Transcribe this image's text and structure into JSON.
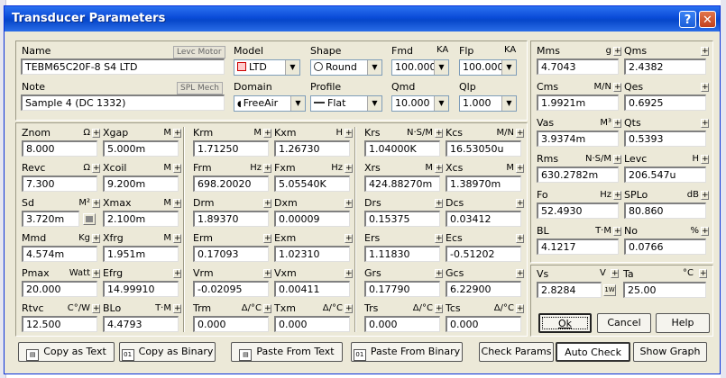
{
  "window": {
    "title": "Transducer Parameters",
    "help_glyph": "?",
    "close_glyph": "✕"
  },
  "header": {
    "name_label": "Name",
    "name_value": "TEBM65C20F-8 S4 LTD",
    "name_button": "Levc Motor",
    "note_label": "Note",
    "note_value": "Sample 4 (DC 1332)",
    "note_button": "SPL Mech",
    "model_label": "Model",
    "model_value": "LTD",
    "shape_label": "Shape",
    "shape_value": "Round",
    "fmd_label": "Fmd",
    "fmd_unit": "KA",
    "fmd_value": "100.000",
    "flp_label": "Flp",
    "flp_unit": "KA",
    "flp_value": "100.000",
    "domain_label": "Domain",
    "domain_value": "FreeAir",
    "profile_label": "Profile",
    "profile_value": "Flat",
    "qmd_label": "Qmd",
    "qmd_value": "10.000",
    "qlp_label": "Qlp",
    "qlp_value": "1.000"
  },
  "params_left": [
    {
      "label": "Znom",
      "unit": "Ω",
      "value": "8.000"
    },
    {
      "label": "Xgap",
      "unit": "M",
      "value": "5.000m"
    },
    {
      "label": "Revc",
      "unit": "Ω",
      "value": "7.300"
    },
    {
      "label": "Xcoil",
      "unit": "M",
      "value": "9.200m"
    },
    {
      "label": "Sd",
      "unit": "M²",
      "value": "3.720m"
    },
    {
      "label": "Xmax",
      "unit": "M",
      "value": "2.100m"
    },
    {
      "label": "Mmd",
      "unit": "Kg",
      "value": "4.574m"
    },
    {
      "label": "Xfrg",
      "unit": "M",
      "value": "1.951m"
    },
    {
      "label": "Pmax",
      "unit": "Watt",
      "value": "20.000"
    },
    {
      "label": "Efrg",
      "unit": "",
      "value": "14.99910"
    },
    {
      "label": "Rtvc",
      "unit": "C°/W",
      "value": "12.500"
    },
    {
      "label": "BLo",
      "unit": "T·M",
      "value": "4.4793"
    }
  ],
  "params_mid": [
    {
      "label": "Krm",
      "unit": "M",
      "value": "1.71250"
    },
    {
      "label": "Kxm",
      "unit": "H",
      "value": "1.26730"
    },
    {
      "label": "Frm",
      "unit": "Hz",
      "value": "698.20020"
    },
    {
      "label": "Fxm",
      "unit": "Hz",
      "value": "5.05540K"
    },
    {
      "label": "Drm",
      "unit": "",
      "value": "1.89370"
    },
    {
      "label": "Dxm",
      "unit": "",
      "value": "0.00009"
    },
    {
      "label": "Erm",
      "unit": "",
      "value": "0.17093"
    },
    {
      "label": "Exm",
      "unit": "",
      "value": "1.02310"
    },
    {
      "label": "Vrm",
      "unit": "",
      "value": "-0.02095"
    },
    {
      "label": "Vxm",
      "unit": "",
      "value": "0.00411"
    },
    {
      "label": "Trm",
      "unit": "Δ/°C",
      "value": "0.000"
    },
    {
      "label": "Txm",
      "unit": "Δ/°C",
      "value": "0.000"
    }
  ],
  "params_right": [
    {
      "label": "Krs",
      "unit": "N·S/M",
      "value": "1.04000K"
    },
    {
      "label": "Kcs",
      "unit": "M/N",
      "value": "16.53050u"
    },
    {
      "label": "Xrs",
      "unit": "M",
      "value": "424.88270m"
    },
    {
      "label": "Xcs",
      "unit": "M",
      "value": "1.38970m"
    },
    {
      "label": "Drs",
      "unit": "",
      "value": "0.15375"
    },
    {
      "label": "Dcs",
      "unit": "",
      "value": "0.03412"
    },
    {
      "label": "Ers",
      "unit": "",
      "value": "1.11830"
    },
    {
      "label": "Ecs",
      "unit": "",
      "value": "-0.51202"
    },
    {
      "label": "Grs",
      "unit": "",
      "value": "0.17790"
    },
    {
      "label": "Gcs",
      "unit": "",
      "value": "6.22900"
    },
    {
      "label": "Trs",
      "unit": "Δ/°C",
      "value": "0.000"
    },
    {
      "label": "Tcs",
      "unit": "Δ/°C",
      "value": "0.000"
    }
  ],
  "results": [
    {
      "label": "Mms",
      "unit": "g",
      "value": "4.7043"
    },
    {
      "label": "Qms",
      "unit": "",
      "value": "2.4382"
    },
    {
      "label": "Cms",
      "unit": "M/N",
      "value": "1.9921m"
    },
    {
      "label": "Qes",
      "unit": "",
      "value": "0.6925"
    },
    {
      "label": "Vas",
      "unit": "M³",
      "value": "3.9374m"
    },
    {
      "label": "Qts",
      "unit": "",
      "value": "0.5393"
    },
    {
      "label": "Rms",
      "unit": "N·S/M",
      "value": "630.2782m"
    },
    {
      "label": "Levc",
      "unit": "H",
      "value": "206.547u"
    },
    {
      "label": "Fo",
      "unit": "Hz",
      "value": "52.4930"
    },
    {
      "label": "SPLo",
      "unit": "dB",
      "value": "80.860"
    },
    {
      "label": "BL",
      "unit": "T·M",
      "value": "4.1217"
    },
    {
      "label": "No",
      "unit": "%",
      "value": "0.0766"
    }
  ],
  "signal": {
    "vs_label": "Vs",
    "vs_unit": "V",
    "vs_value": "2.8284",
    "vs_button": "1W",
    "ta_label": "Ta",
    "ta_unit": "°C",
    "ta_value": "25.00"
  },
  "dialog_buttons": {
    "ok": "Ok",
    "cancel": "Cancel",
    "help": "Help"
  },
  "toolbar": {
    "copy_text": "Copy as Text",
    "copy_binary": "Copy as Binary",
    "paste_text": "Paste From Text",
    "paste_binary": "Paste From Binary",
    "check_params": "Check Params",
    "auto_check": "Auto Check",
    "show_graph": "Show Graph"
  }
}
